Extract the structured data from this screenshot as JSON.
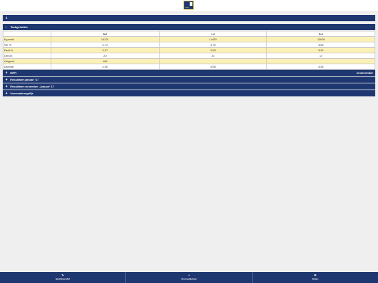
{
  "header": {
    "logo_text": "CRV"
  },
  "sections": {
    "empty_bar": {
      "sign": "+"
    },
    "tankgegevens": {
      "sign": "-",
      "title": "Tankgehalten"
    },
    "mpr": {
      "sign": "+",
      "title": "MPR",
      "date": "23 december"
    },
    "resultaten_januari": {
      "sign": "+",
      "title": "Resultaten januari '17"
    },
    "resultaten_nov_jan": {
      "sign": "+",
      "title": "Resultaten november - januari '17"
    },
    "voorraadvergelijk": {
      "sign": "+",
      "title": "Voorraadvergelijk"
    }
  },
  "table": {
    "columns": [
      "",
      "8-2",
      "7-2",
      "0-2"
    ],
    "rows": [
      {
        "label": "Kg melk",
        "values": [
          "16221",
          "14425",
          "15929"
        ]
      },
      {
        "label": "Vet %",
        "values": [
          "4.74",
          "4.70",
          "4.60"
        ]
      },
      {
        "label": "Eiwit %",
        "values": [
          "3.57",
          "3.53",
          "3.53"
        ]
      },
      {
        "label": "Ureum",
        "values": [
          "20",
          "23",
          "17"
        ]
      },
      {
        "label": "Celgetal",
        "values": [
          "165",
          "",
          ""
        ]
      },
      {
        "label": "Lactose",
        "values": [
          "4.55",
          "4.55",
          "4.55"
        ]
      }
    ]
  },
  "footer": {
    "items": [
      {
        "icon": "pencil-icon",
        "glyph": "✎",
        "label": "Bedrijfsprofiel"
      },
      {
        "icon": "plus-icon",
        "glyph": "+",
        "label": "Voorraadbeheer"
      },
      {
        "icon": "gear-icon",
        "glyph": "⚙",
        "label": "Opties"
      }
    ]
  },
  "colors": {
    "brand": "#1f3770",
    "highlight_row": "#fbf1b7"
  }
}
